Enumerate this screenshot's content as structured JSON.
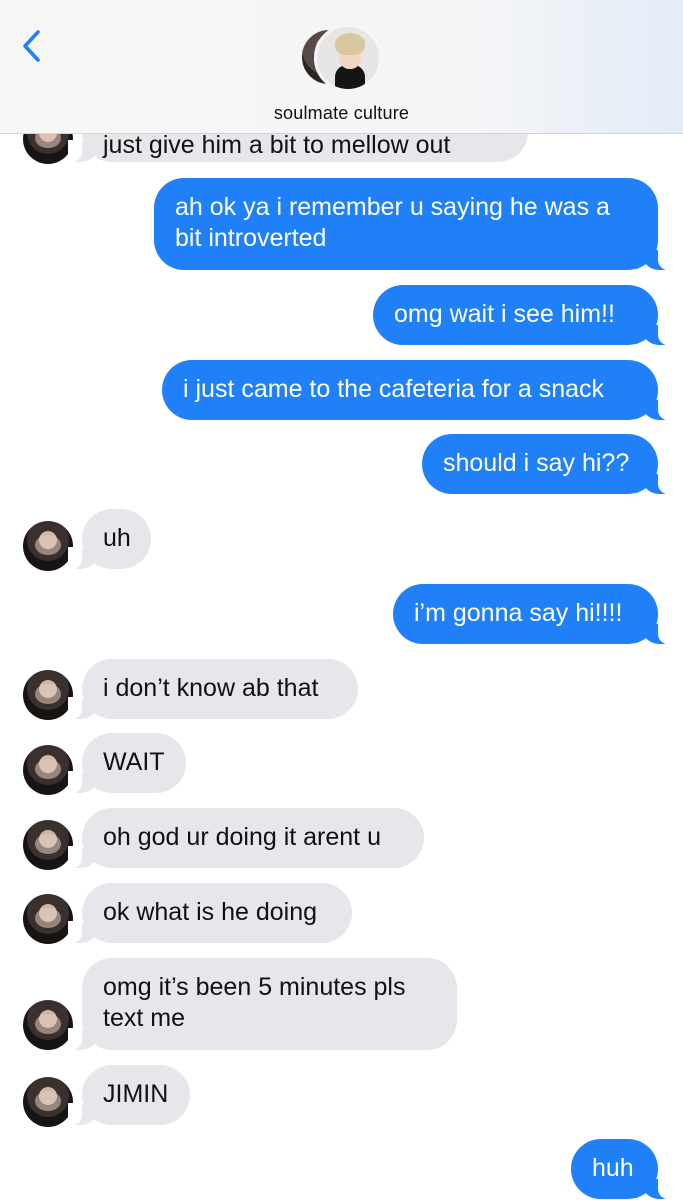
{
  "header": {
    "back_icon": "chevron-left-icon",
    "contact_name": "soulmate culture",
    "accent_color": "#1f80f8"
  },
  "messages": [
    {
      "dir": "in",
      "text": "just give him a bit to mellow out"
    },
    {
      "dir": "out",
      "text": "ah ok ya i remember u saying he was a",
      "text2": "bit introverted"
    },
    {
      "dir": "out",
      "text": "omg wait i see him!!"
    },
    {
      "dir": "out",
      "text": "i just came to the cafeteria for a snack"
    },
    {
      "dir": "out",
      "text": "should i say hi??"
    },
    {
      "dir": "in",
      "text": "uh"
    },
    {
      "dir": "out",
      "text": "i’m gonna say hi!!!!"
    },
    {
      "dir": "in",
      "text": "i don’t know ab that"
    },
    {
      "dir": "in",
      "text": "WAIT"
    },
    {
      "dir": "in",
      "text": "oh god ur doing it arent u"
    },
    {
      "dir": "in",
      "text": "ok what is he doing"
    },
    {
      "dir": "in",
      "text": "omg it’s been 5 minutes pls",
      "text2": "text me"
    },
    {
      "dir": "in",
      "text": "JIMIN"
    },
    {
      "dir": "out",
      "text": "huh"
    }
  ]
}
